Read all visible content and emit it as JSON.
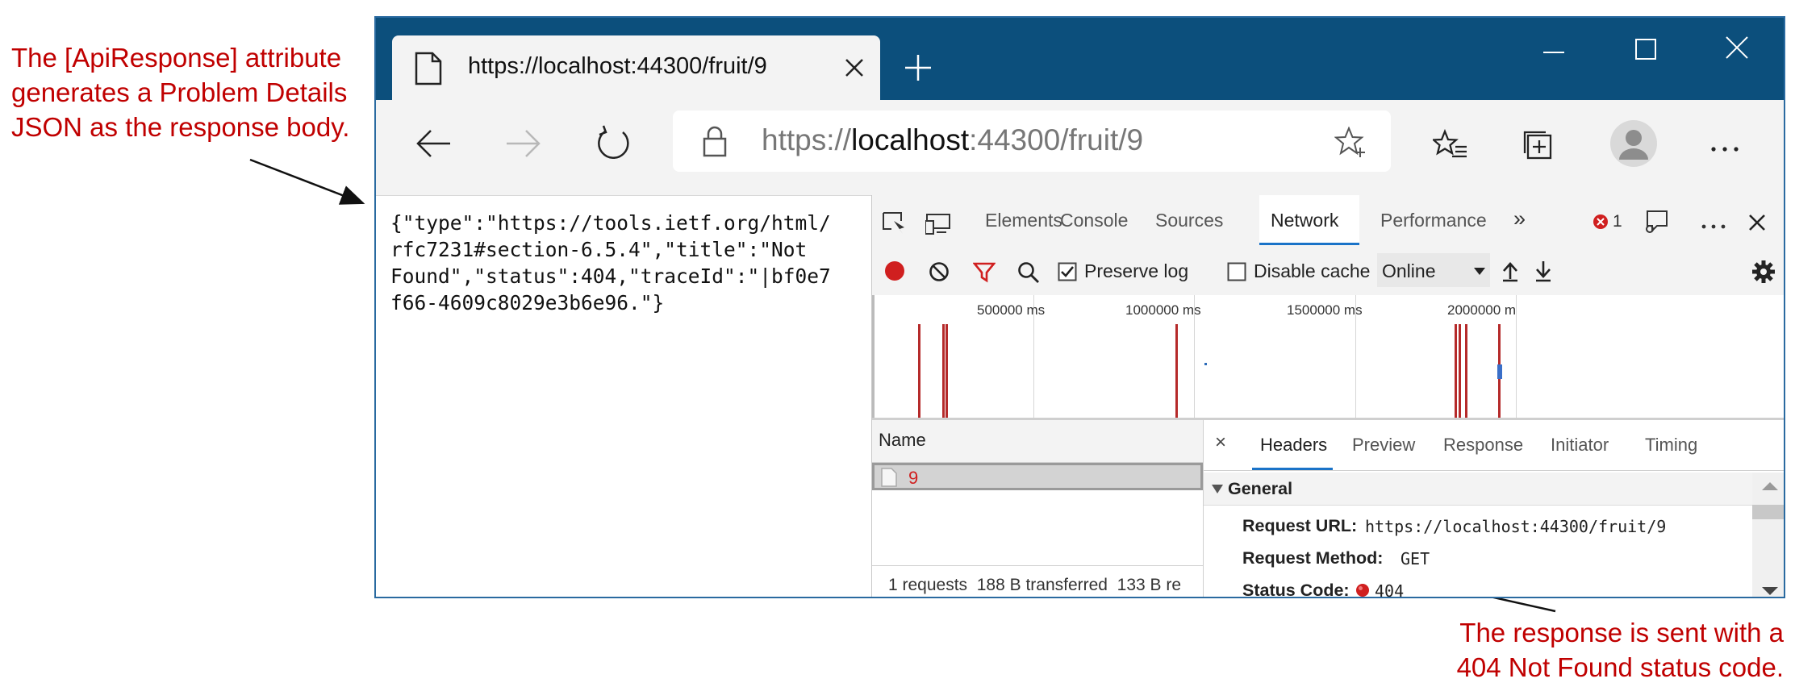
{
  "annotations": {
    "left": "The [ApiResponse] attribute\ngenerates a Problem Details\nJSON as the response body.",
    "bottom": "The response is sent with a\n404 Not Found status code."
  },
  "browser": {
    "tab_title": "https://localhost:44300/fruit/9",
    "url_scheme": "https://",
    "url_host": "localhost",
    "url_rest": ":44300/fruit/9",
    "page_body": "{\"type\":\"https://tools.ietf.org/html/\nrfc7231#section-6.5.4\",\"title\":\"Not\nFound\",\"status\":404,\"traceId\":\"|bf0e7\nf66-4609c8029e3b6e96.\"}"
  },
  "devtools": {
    "tabs": [
      "Elements",
      "Console",
      "Sources",
      "Network",
      "Performance"
    ],
    "active_tab": "Network",
    "more_tabs": "»",
    "error_count": "1",
    "toolbar": {
      "preserve_log": "Preserve log",
      "preserve_log_checked": true,
      "disable_cache": "Disable cache",
      "disable_cache_checked": false,
      "throttling": "Online"
    },
    "timeline_ticks": [
      "500000 ms",
      "1000000 ms",
      "1500000 ms",
      "2000000 m"
    ],
    "requests": {
      "column": "Name",
      "rows": [
        {
          "name": "9",
          "status": "error"
        }
      ],
      "summary": "1 requests  188 B transferred  133 B re"
    },
    "detail_tabs": [
      "Headers",
      "Preview",
      "Response",
      "Initiator",
      "Timing"
    ],
    "active_detail_tab": "Headers",
    "close_symbol": "×",
    "general": {
      "title": "General",
      "request_url_label": "Request URL:",
      "request_url": "https://localhost:44300/fruit/9",
      "method_label": "Request Method:",
      "method": "GET",
      "status_label": "Status Code:",
      "status": "404"
    }
  },
  "colors": {
    "annotation": "#c00000",
    "titlebar": "#0c4f7c",
    "active_tab_underline": "#1a73c8",
    "error_red": "#d01f1f"
  }
}
